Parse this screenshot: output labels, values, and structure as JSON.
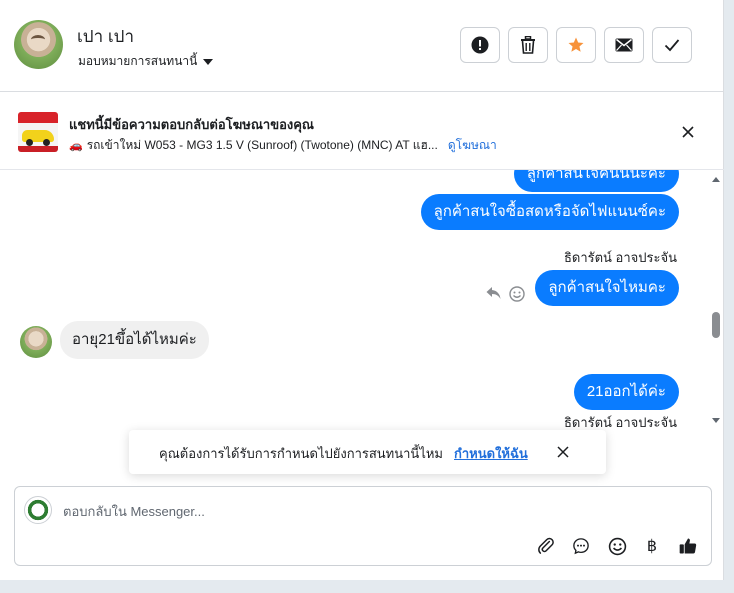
{
  "header": {
    "user_name": "เปา เปา",
    "assign_label": "มอบหมายการสนทนานี้",
    "buttons": [
      "report-spam",
      "delete",
      "star",
      "mark-unread",
      "mark-done"
    ]
  },
  "ad_banner": {
    "title": "แชทนี้มีข้อความตอบกลับต่อโฆษณาของคุณ",
    "subtitle": "รถเข้าใหม่ W053 - MG3 1.5 V (Sunroof) (Twotone) (MNC) AT แฮ...",
    "link": "ดูโฆษณา",
    "car_icon": "🚗"
  },
  "messages": [
    {
      "dir": "out",
      "text": "ลูกค้าสนใจคันนี้นะคะ"
    },
    {
      "dir": "out",
      "text": "ลูกค้าสนใจซื้อสดหรือจัดไฟแนนซ์คะ"
    },
    {
      "dir": "out_sender",
      "text": "ธิดารัตน์ อาจประจัน"
    },
    {
      "dir": "out",
      "text": "ลูกค้าสนใจไหมคะ"
    },
    {
      "dir": "in",
      "text": "อายุ21ขึ้อได้ไหมค่ะ"
    },
    {
      "dir": "out",
      "text": "21ออกได้ค่ะ"
    },
    {
      "dir": "out_sender",
      "text": "ธิดารัตน์ อาจประจัน"
    }
  ],
  "toast": {
    "text": "คุณต้องการได้รับการกำหนดไปยังการสนทนานี้ไหม",
    "link": "กำหนดให้ฉัน"
  },
  "composer": {
    "placeholder": "ตอบกลับใน Messenger...",
    "icons": [
      "paperclip-icon",
      "chat-bubble-icon",
      "emoji-icon",
      "baht-icon",
      "thumbs-up-icon"
    ],
    "baht_symbol": "฿"
  },
  "colors": {
    "accent": "#0a7cff",
    "star": "#f7923a",
    "link": "#216fdb"
  }
}
